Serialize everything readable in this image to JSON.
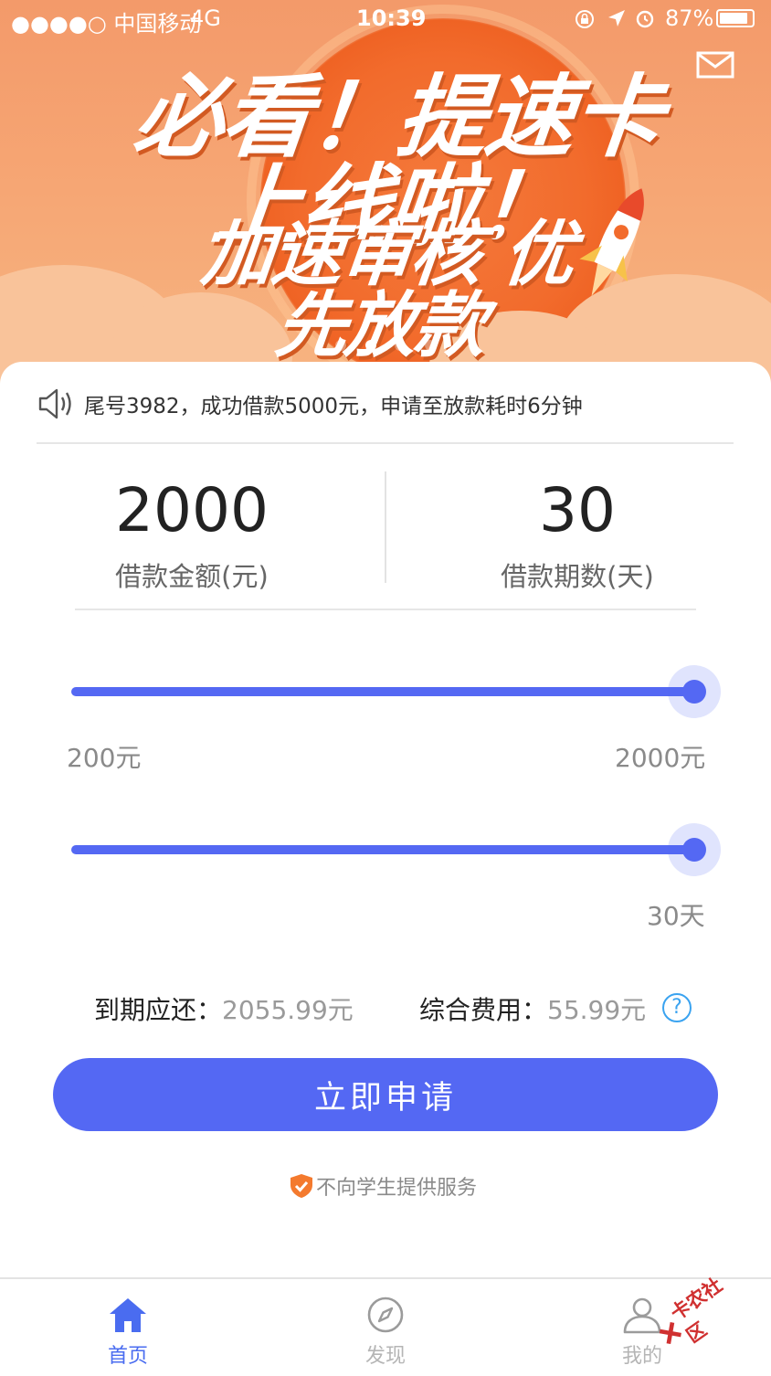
{
  "status_bar": {
    "carrier": "●●●●○ 中国移动",
    "network": "4G",
    "time": "10:39",
    "battery": "87%"
  },
  "banner": {
    "headline": "必看！提速卡上线啦！",
    "subline": "加速审核 优先放款",
    "active_dot": 1,
    "dot_count": 4
  },
  "notice": {
    "text": "尾号3982，成功借款5000元，申请至放款耗时6分钟"
  },
  "amount": {
    "value": "2000",
    "label": "借款金额(元)"
  },
  "term": {
    "value": "30",
    "label": "借款期数(天)"
  },
  "amount_slider": {
    "min_label": "200元",
    "max_label": "2000元",
    "min": 200,
    "max": 2000,
    "value": 2000
  },
  "term_slider": {
    "max_label": "30天",
    "value_fraction": 1.0
  },
  "summary": {
    "due_key": "到期应还：",
    "due_value": "2055.99元",
    "fee_key": "综合费用：",
    "fee_value": "55.99元",
    "help_symbol": "?"
  },
  "apply_button": {
    "label": "立即申请"
  },
  "disclaimer": {
    "text": "不向学生提供服务"
  },
  "tabbar": {
    "items": [
      {
        "label": "首页",
        "icon": "home-icon",
        "active": true
      },
      {
        "label": "发现",
        "icon": "compass-icon",
        "active": false
      },
      {
        "label": "我的",
        "icon": "user-icon",
        "active": false
      }
    ]
  },
  "watermark": {
    "text": "卡农社区"
  },
  "colors": {
    "accent": "#5468f3",
    "banner": "#f6a573",
    "shield": "#f47a2e"
  }
}
